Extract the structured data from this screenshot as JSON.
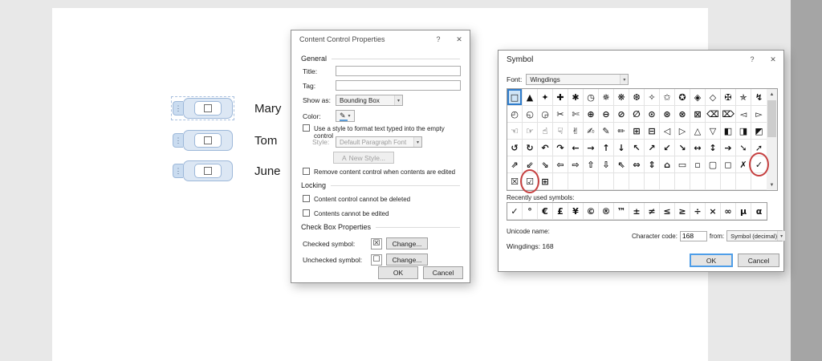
{
  "colors": {
    "accent": "#0078d7",
    "annotation_red": "#c64040",
    "control_blue": "#9db8d9"
  },
  "ui": {
    "dropdown_arrow": "▾",
    "scroll_up": "▲",
    "scroll_down": "▼",
    "grip_dots": "⋮"
  },
  "document": {
    "names": [
      "Mary",
      "Tom",
      "June"
    ]
  },
  "properties_dialog": {
    "title": "Content Control Properties",
    "help": "?",
    "close": "✕",
    "sections": {
      "general": "General",
      "locking": "Locking",
      "checkbox": "Check Box Properties"
    },
    "fields": {
      "title_label": "Title:",
      "title_value": "",
      "tag_label": "Tag:",
      "tag_value": "",
      "show_as_label": "Show as:",
      "show_as_value": "Bounding Box",
      "color_label": "Color:",
      "color_icon": "✎",
      "style_checkbox": "Use a style to format text typed into the empty control",
      "style_label": "Style:",
      "style_value": "Default Paragraph Font",
      "new_style_icon": "A",
      "new_style_button": "New Style...",
      "remove_checkbox": "Remove content control when contents are edited",
      "lock_delete": "Content control cannot be deleted",
      "lock_edit": "Contents cannot be edited",
      "checked_label": "Checked symbol:",
      "checked_glyph": "☒",
      "unchecked_label": "Unchecked symbol:",
      "unchecked_glyph": "☐",
      "change_button": "Change...",
      "ok": "OK",
      "cancel": "Cancel"
    }
  },
  "symbol_dialog": {
    "title": "Symbol",
    "help": "?",
    "close": "✕",
    "font_label": "Font:",
    "font_value": "Wingdings",
    "selected": {
      "row": 0,
      "col": 0
    },
    "circled": [
      {
        "row": 4,
        "col": 16
      },
      {
        "row": 5,
        "col": 1
      }
    ],
    "grid": [
      [
        "□",
        "▲",
        "✦",
        "✚",
        "✱",
        "◷",
        "✵",
        "❋",
        "❆",
        "✧",
        "✩",
        "✪",
        "◈",
        "◇",
        "✠",
        "✯",
        "↯"
      ],
      [
        "◴",
        "◵",
        "◶",
        "✂",
        "✄",
        "⊕",
        "⊖",
        "⊘",
        "∅",
        "⊙",
        "⊛",
        "⊗",
        "⊠",
        "⌫",
        "⌦",
        "◅",
        "▻"
      ],
      [
        "☜",
        "☞",
        "☝",
        "☟",
        "✌",
        "✍",
        "✎",
        "✏",
        "⊞",
        "⊟",
        "◁",
        "▷",
        "△",
        "▽",
        "◧",
        "◨",
        "◩"
      ],
      [
        "↺",
        "↻",
        "↶",
        "↷",
        "←",
        "→",
        "↑",
        "↓",
        "↖",
        "↗",
        "↙",
        "↘",
        "↔",
        "↕",
        "➔",
        "➘",
        "➚"
      ],
      [
        "⇗",
        "⇙",
        "⇘",
        "⇦",
        "⇨",
        "⇧",
        "⇩",
        "⇖",
        "⇔",
        "⇕",
        "⌂",
        "▭",
        "▫",
        "▢",
        "◻",
        "✗",
        "✓"
      ],
      [
        "☒",
        "☑",
        "⊞",
        "",
        "",
        "",
        "",
        "",
        "",
        "",
        "",
        "",
        "",
        "",
        "",
        "",
        ""
      ]
    ],
    "recent_label": "Recently used symbols:",
    "recent": [
      "✓",
      "°",
      "€",
      "£",
      "¥",
      "©",
      "®",
      "™",
      "±",
      "≠",
      "≤",
      "≥",
      "÷",
      "×",
      "∞",
      "µ",
      "α"
    ],
    "unicode_name_label": "Unicode name:",
    "unicode_name": "Wingdings: 168",
    "char_code_label": "Character code:",
    "char_code": "168",
    "from_label": "from:",
    "from_value": "Symbol (decimal)",
    "ok": "OK",
    "cancel": "Cancel"
  }
}
